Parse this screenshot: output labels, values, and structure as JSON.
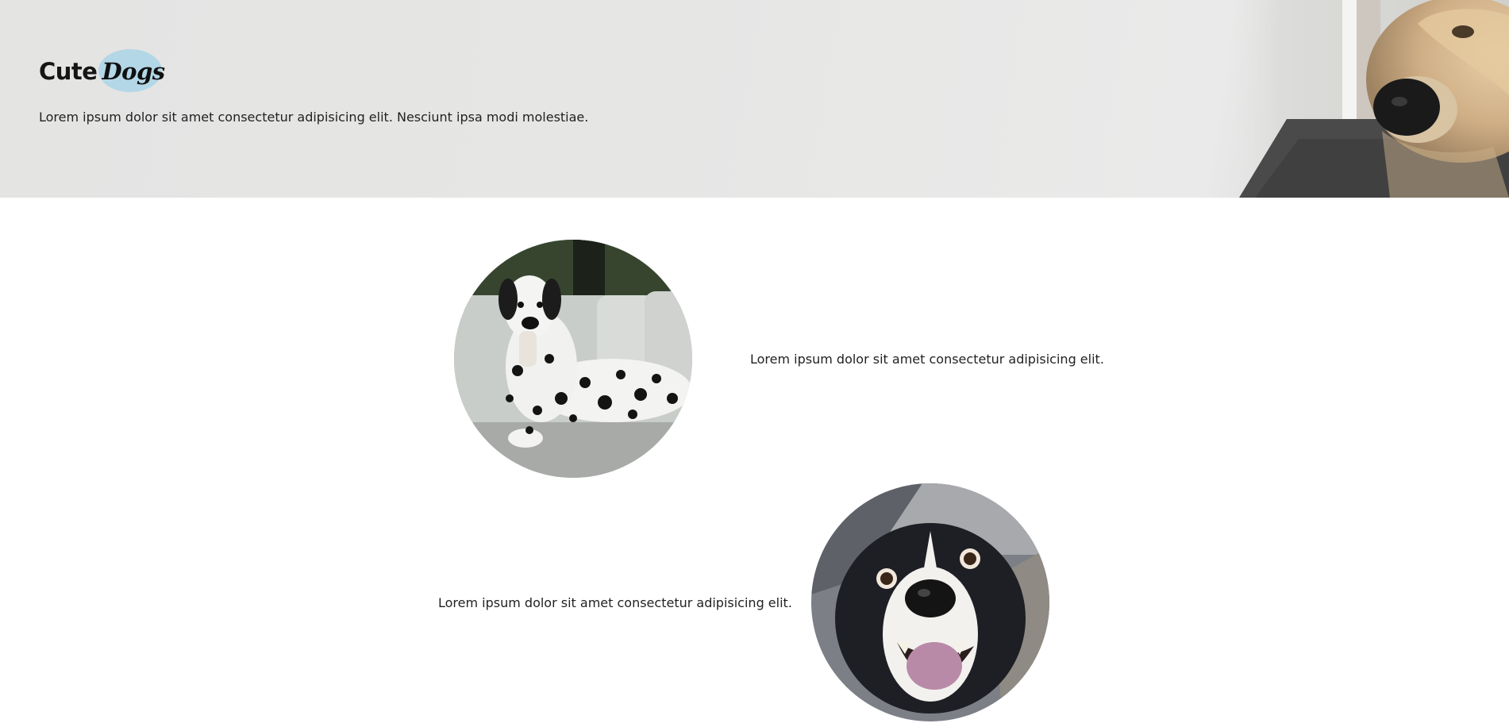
{
  "hero": {
    "logo": {
      "word_1": "Cute",
      "word_2": "Dogs",
      "accent_color": "#b3d7e7"
    },
    "tagline": "Lorem ipsum dolor sit amet consectetur adipisicing elit. Nesciunt ipsa modi molestiae.",
    "background_color": "#e6e6e5"
  },
  "features": [
    {
      "image": "dalmatian-photo",
      "text": "Lorem ipsum dolor sit amet consectetur adipisicing elit."
    },
    {
      "image": "border-collie-photo",
      "text": "Lorem ipsum dolor sit amet consectetur adipisicing elit."
    }
  ]
}
